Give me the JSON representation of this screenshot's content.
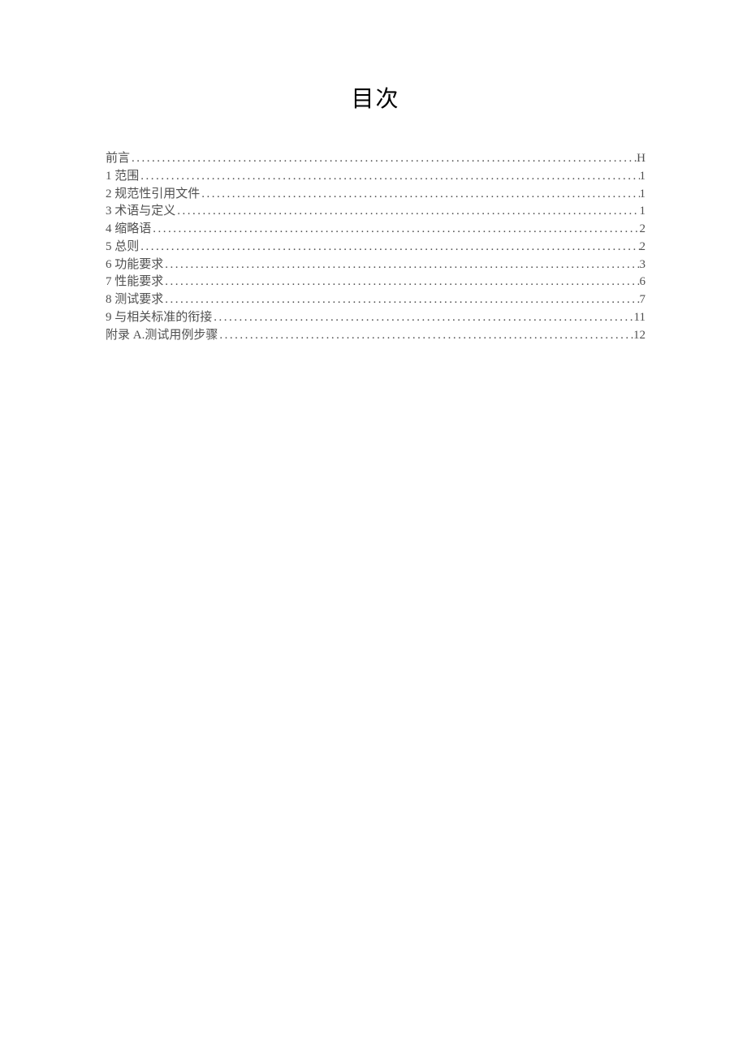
{
  "title": "目次",
  "toc": [
    {
      "label": "前言",
      "page": "H"
    },
    {
      "label": "1 范围",
      "page": "1"
    },
    {
      "label": "2 规范性引用文件",
      "page": "1"
    },
    {
      "label": "3 术语与定义",
      "page": "1"
    },
    {
      "label": "4 缩略语",
      "page": "2"
    },
    {
      "label": "5 总则",
      "page": "2"
    },
    {
      "label": "6 功能要求",
      "page": "3"
    },
    {
      "label": "7 性能要求",
      "page": "6"
    },
    {
      "label": "8 测试要求",
      "page": "7"
    },
    {
      "label": "9 与相关标准的衔接",
      "page": "11"
    },
    {
      "label": "附录 A.测试用例步骤",
      "page": "12"
    }
  ]
}
